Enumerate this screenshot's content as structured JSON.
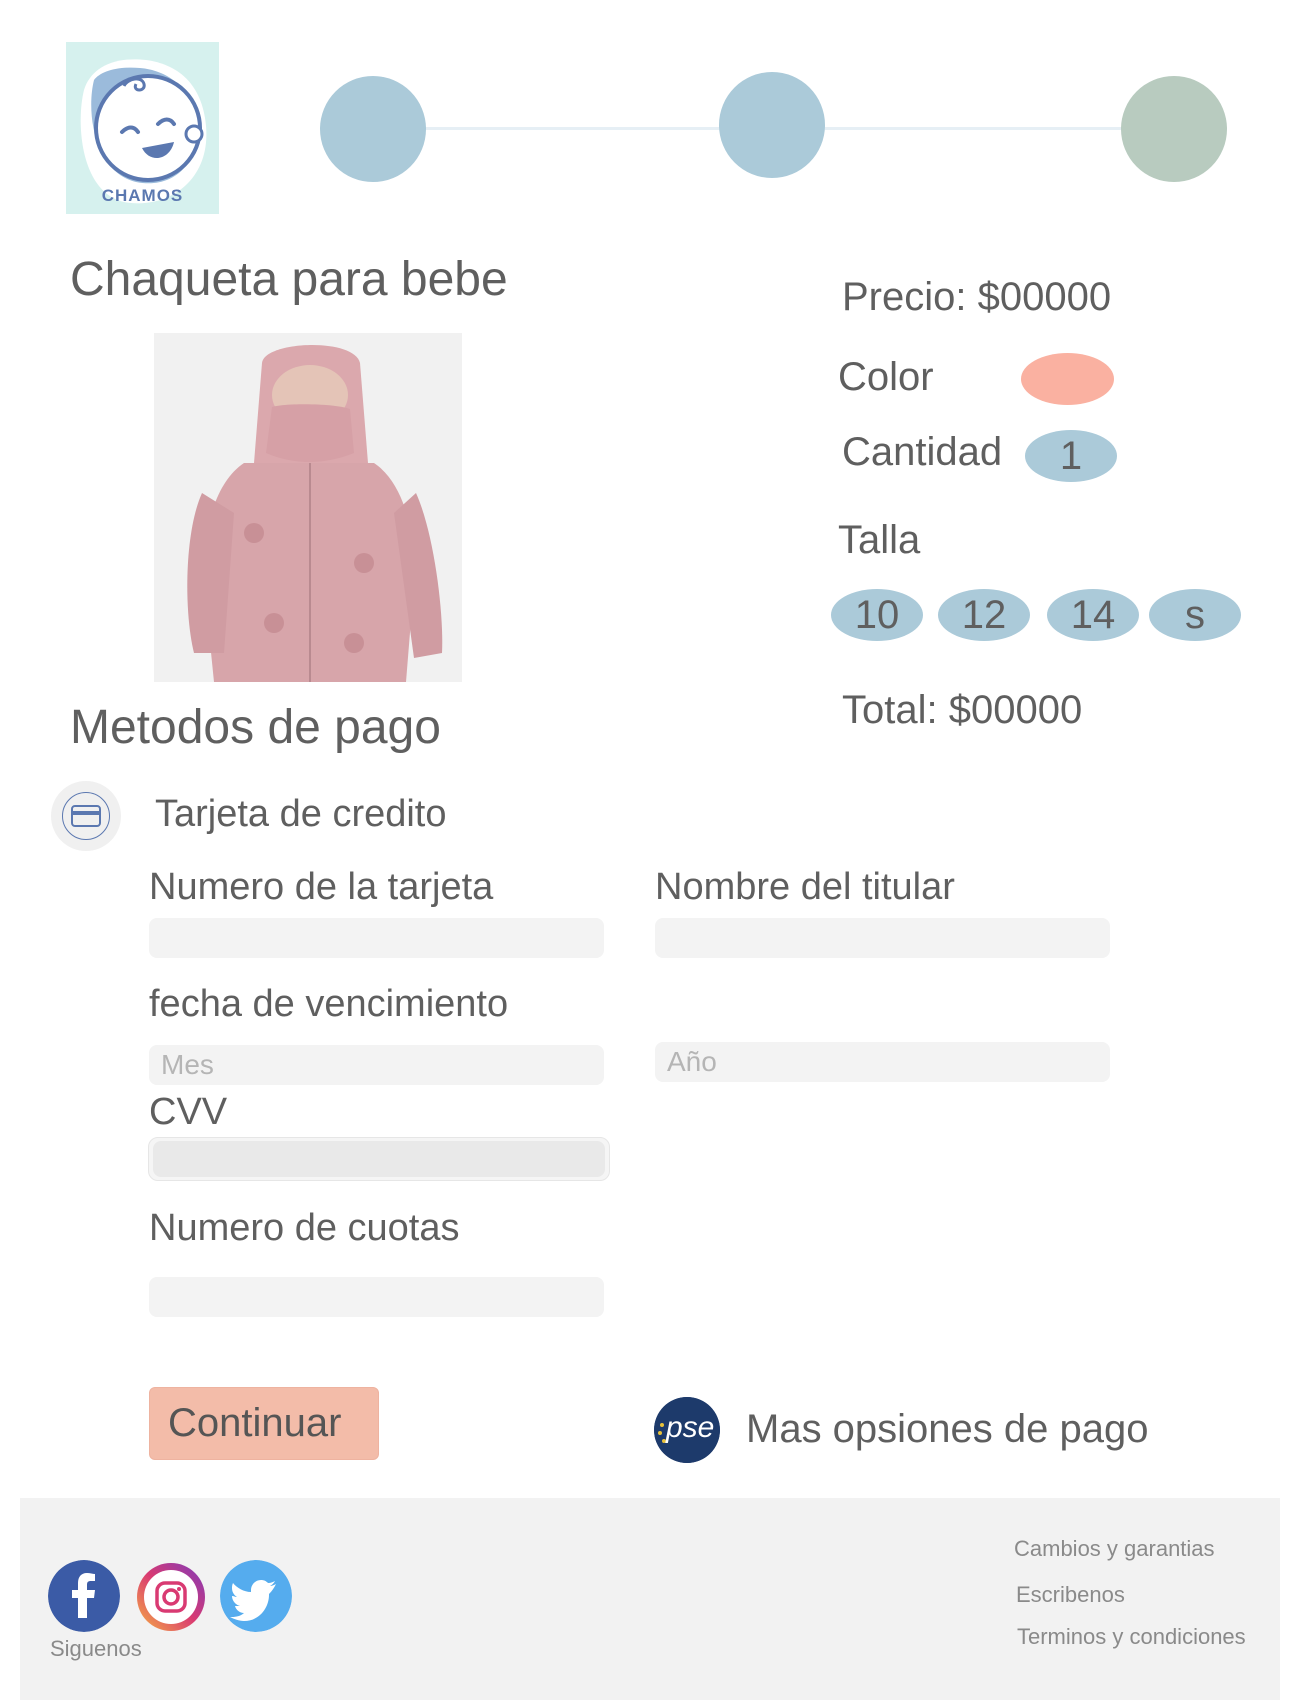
{
  "brand": {
    "name": "CHAMOS"
  },
  "product": {
    "title": "Chaqueta para bebe",
    "price_label": "Precio: $00000",
    "color_label": "Color",
    "color_value": "#fab1a1",
    "quantity_label": "Cantidad",
    "quantity_value": "1",
    "size_label": "Talla",
    "sizes": [
      "10",
      "12",
      "14",
      "s"
    ],
    "total_label": "Total:  $00000"
  },
  "payment": {
    "section_title": "Metodos de pago",
    "credit_card_label": "Tarjeta de credito",
    "card_number_label": "Numero de la tarjeta",
    "holder_name_label": "Nombre del titular",
    "expiry_label": "fecha de vencimiento",
    "month_placeholder": "Mes",
    "year_placeholder": "Año",
    "cvv_label": "CVV",
    "installments_label": "Numero de cuotas",
    "continue_label": "Continuar",
    "pse_logo_text": "pse",
    "more_options_label": "Mas opsiones de pago"
  },
  "footer": {
    "follow_label": "Siguenos",
    "links": [
      "Cambios y garantias",
      "Escribenos",
      "Terminos y condiciones"
    ]
  },
  "colors": {
    "accent_blue": "#abcad9",
    "accent_green": "#b8cbbf",
    "accent_peach": "#f3bca9"
  },
  "icons": {
    "logo": "baby-face-icon",
    "card": "credit-card-icon",
    "social": [
      "facebook-icon",
      "instagram-icon",
      "twitter-icon"
    ]
  }
}
